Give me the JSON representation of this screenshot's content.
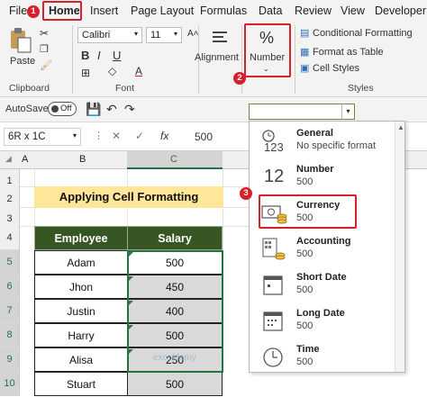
{
  "tabs": [
    "File",
    "Home",
    "Insert",
    "Page Layout",
    "Formulas",
    "Data",
    "Review",
    "View",
    "Developer"
  ],
  "steps": [
    "1",
    "2",
    "3"
  ],
  "ribbon": {
    "paste_label": "Paste",
    "clipboard_label": "Clipboard",
    "font_name": "Calibri",
    "font_size": "11",
    "font_label": "Font",
    "alignment_label": "Alignment",
    "number_label": "Number",
    "number_symbol": "%",
    "conditional_formatting": "Conditional Formatting",
    "format_as_table": "Format as Table",
    "cell_styles": "Cell Styles",
    "styles_label": "Styles",
    "bold": "B",
    "italic": "I",
    "underline": "U"
  },
  "qat": {
    "autosave_label": "AutoSave",
    "toggle_state": "Off"
  },
  "formula_bar": {
    "name_box": "6R x 1C",
    "fx": "fx",
    "value": "500"
  },
  "grid": {
    "columns": [
      "A",
      "B",
      "C"
    ],
    "rows": [
      "1",
      "2",
      "3",
      "4",
      "5",
      "6",
      "7",
      "8",
      "9",
      "10"
    ],
    "title": "Applying Cell Formatting",
    "headers": {
      "employee": "Employee",
      "salary": "Salary"
    },
    "data": [
      {
        "employee": "Adam",
        "salary": "500"
      },
      {
        "employee": "Jhon",
        "salary": "450"
      },
      {
        "employee": "Justin",
        "salary": "400"
      },
      {
        "employee": "Harry",
        "salary": "500"
      },
      {
        "employee": "Alisa",
        "salary": "250"
      },
      {
        "employee": "Stuart",
        "salary": "500"
      }
    ]
  },
  "dropdown": {
    "items": [
      {
        "name": "General",
        "sub": "No specific format",
        "icon": "clock-123-icon"
      },
      {
        "name": "Number",
        "sub": "500",
        "icon": "number-12-icon"
      },
      {
        "name": "Currency",
        "sub": "500",
        "icon": "currency-money-icon"
      },
      {
        "name": "Accounting",
        "sub": "500",
        "icon": "accounting-icon"
      },
      {
        "name": "Short Date",
        "sub": "500",
        "icon": "short-date-calendar-icon"
      },
      {
        "name": "Long Date",
        "sub": "500",
        "icon": "long-date-calendar-icon"
      },
      {
        "name": "Time",
        "sub": "500",
        "icon": "time-clock-icon"
      }
    ],
    "icon_text_general": "123",
    "icon_text_number": "12"
  },
  "watermark": "exceldemy",
  "colors": {
    "accent_red": "#d6202a",
    "header_green": "#375623",
    "title_yellow": "#ffe699",
    "selected_gray": "#d9d9d9"
  }
}
